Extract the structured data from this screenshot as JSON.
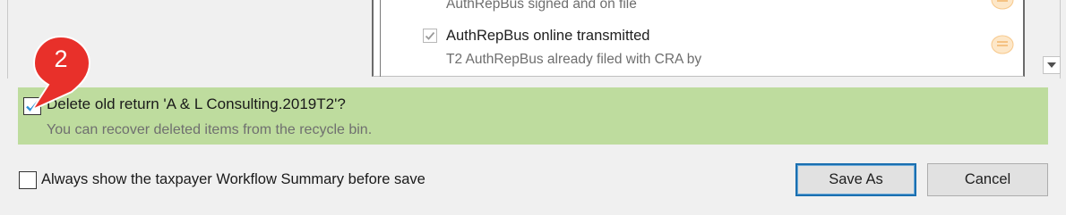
{
  "checklist": {
    "partial_item_subtext": "AuthRepBus signed and on file",
    "item": {
      "title": "AuthRepBus online transmitted",
      "subtext": "T2 AuthRepBus already filed with CRA by",
      "checked": true
    }
  },
  "callout": {
    "number": "2",
    "color": "#e8302a"
  },
  "delete_option": {
    "label": "Delete old return 'A & L Consulting.2019T2'?",
    "note": "You can recover deleted items from the recycle bin.",
    "checked": true,
    "highlight_color": "#bedc9e"
  },
  "footer": {
    "always_show_label": "Always show the taxpayer Workflow Summary before save",
    "always_show_checked": false,
    "save_as_label": "Save As",
    "cancel_label": "Cancel"
  },
  "icons": {
    "note": "note-icon",
    "scroll_down": "chevron-down-icon",
    "check": "check-icon"
  }
}
